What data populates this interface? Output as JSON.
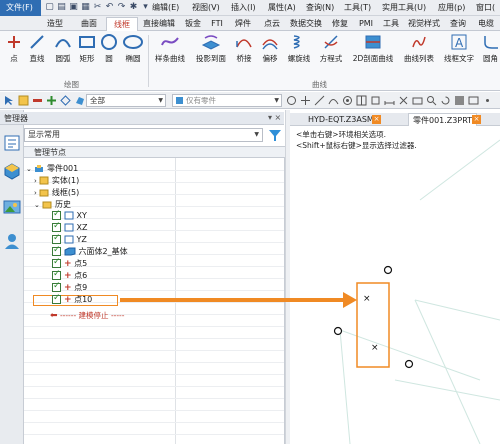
{
  "menubar": {
    "file": "文件(F)",
    "items": [
      "文件(F)",
      "编辑(E)",
      "视图(V)",
      "插入(I)",
      "属性(A)",
      "查询(N)",
      "工具(T)",
      "实用工具(U)",
      "应用(p)",
      "窗口("
    ]
  },
  "ribbon_tabs": [
    "造型",
    "曲面",
    "线框",
    "直接编辑",
    "钣金",
    "FTI",
    "焊件",
    "点云",
    "数据交换",
    "修复",
    "PMI",
    "工具",
    "视觉样式",
    "查询",
    "电缆"
  ],
  "active_tab": "线框",
  "ribbon": {
    "buttons_left": [
      "点",
      "直线",
      "圆弧",
      "矩形",
      "圆",
      "椭圆"
    ],
    "group_left": "绘图",
    "buttons_right": [
      "样条曲线",
      "投影到面",
      "桥接",
      "偏移",
      "螺旋线",
      "方程式",
      "2D剖面曲线",
      "曲线列表",
      "线框文字",
      "圆角"
    ],
    "group_right": "曲线"
  },
  "toolbar": {
    "filter_all": "全部",
    "filter_part": "仅有零件"
  },
  "manager": {
    "title": "管理器",
    "filter_value": "显示常用",
    "tree_header": "管理节点",
    "nodes": {
      "root": "零件001",
      "solid": "实体(1)",
      "wire": "线框(5)",
      "history": "历史",
      "xy": "XY",
      "xz": "XZ",
      "yz": "YZ",
      "hexa": "六面体2_基体",
      "p5": "点5",
      "p6": "点6",
      "p9": "点9",
      "p10": "点10",
      "stop": "------ 建模停止 -----"
    }
  },
  "viewport": {
    "tab1": "HYD-EQT.Z3ASM",
    "tab2": "零件001.Z3PRT",
    "hint1": "<单击右键>环境相关选项.",
    "hint2": "<Shift+鼠标右键>显示选择过滤器."
  },
  "colors": {
    "accent": "#f08a24",
    "file_menu": "#2f6db3",
    "active_tab_text": "#c0392b"
  }
}
